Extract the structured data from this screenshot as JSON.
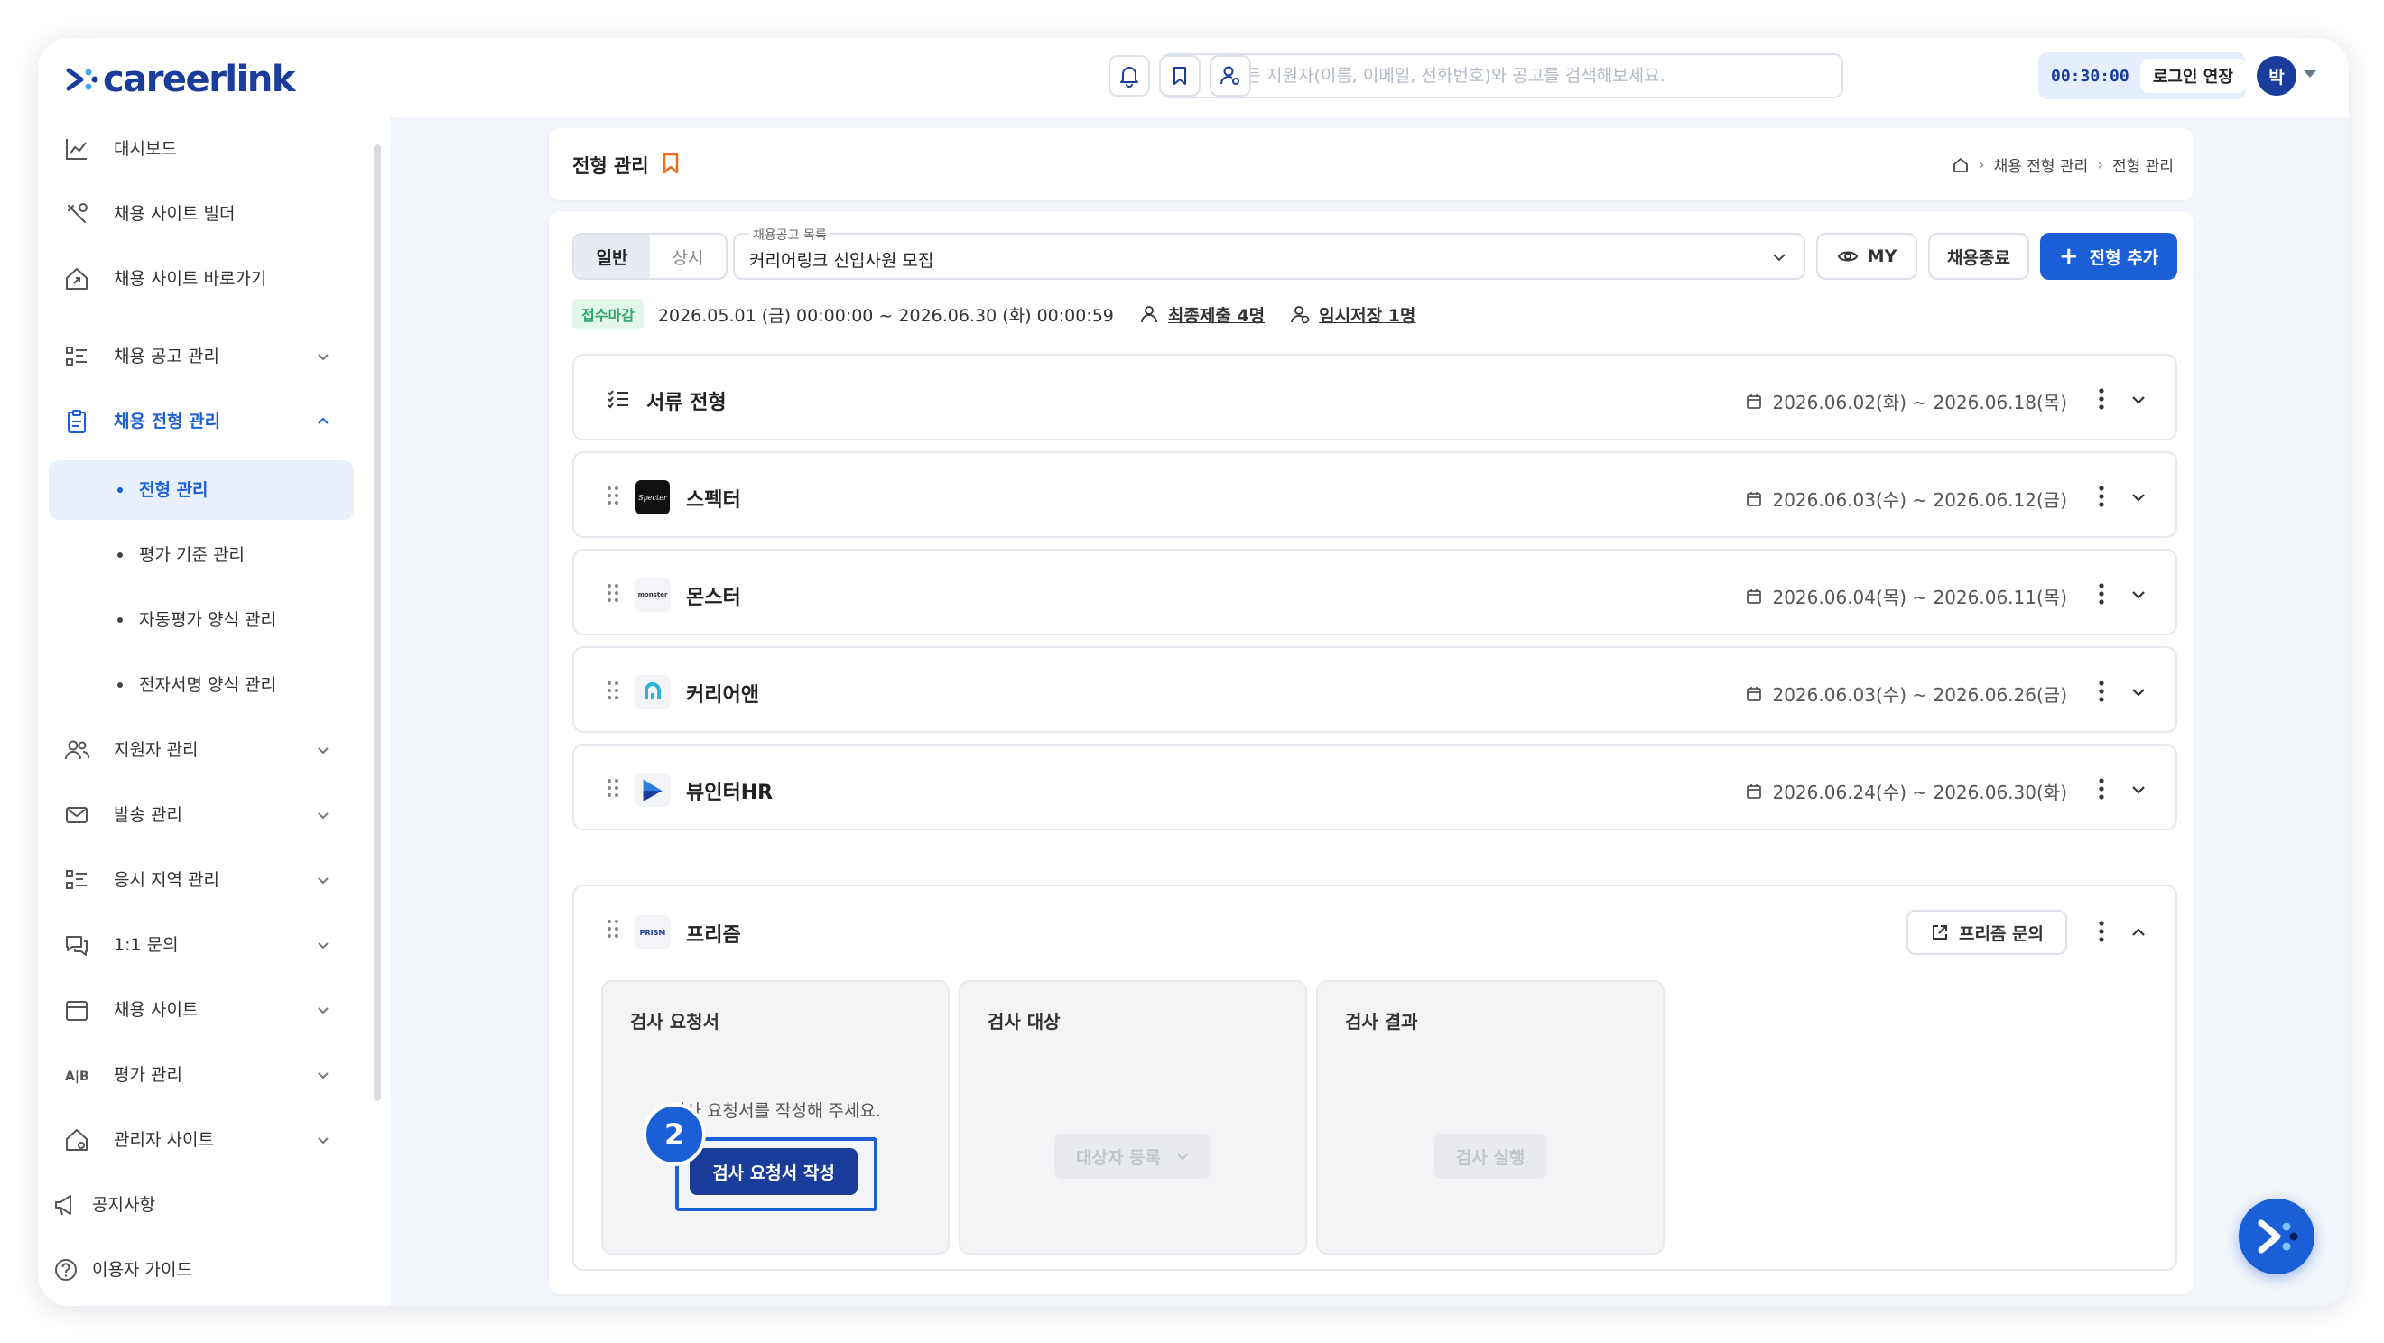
{
  "header": {
    "brand": "careerlink",
    "search_placeholder": "모든 지원자(이름, 이메일, 전화번호)와 공고를 검색해보세요.",
    "session_timer": "00:30:00",
    "extend_login_label": "로그인 연장",
    "avatar_initial": "박",
    "accent_color": "#1a5fd6"
  },
  "sidebar": {
    "items": [
      {
        "label": "대시보드",
        "icon": "chart-icon"
      },
      {
        "label": "채용 사이트 빌더",
        "icon": "tools-icon"
      },
      {
        "label": "채용 사이트 바로가기",
        "icon": "home-link-icon"
      },
      {
        "label": "채용 공고 관리",
        "icon": "list-icon"
      },
      {
        "label": "채용 전형 관리",
        "icon": "clipboard-icon"
      },
      {
        "label": "지원자 관리",
        "icon": "users-icon"
      },
      {
        "label": "발송 관리",
        "icon": "mail-icon"
      },
      {
        "label": "응시 지역 관리",
        "icon": "list-icon"
      },
      {
        "label": "1:1 문의",
        "icon": "chat-icon"
      },
      {
        "label": "채용 사이트",
        "icon": "calendar-icon"
      },
      {
        "label": "평가 관리",
        "icon": "ab-icon"
      },
      {
        "label": "관리자 사이트",
        "icon": "home-gear-icon"
      }
    ],
    "subitems": [
      "전형 관리",
      "평가 기준 관리",
      "자동평가 양식 관리",
      "전자서명 양식 관리"
    ],
    "bottom": [
      "공지사항",
      "이용자 가이드"
    ]
  },
  "page": {
    "title": "전형 관리",
    "breadcrumb": [
      "채용 전형 관리",
      "전형 관리"
    ]
  },
  "toolbar": {
    "tab_general": "일반",
    "tab_regular": "상시",
    "select_caption": "채용공고 목록",
    "select_value": "커리어링크 신입사원 모집",
    "my_label": "MY",
    "end_label": "채용종료",
    "add_label": "전형 추가"
  },
  "status": {
    "badge": "접수마감",
    "period": "2026.05.01 (금) 00:00:00 ~ 2026.06.30 (화) 00:00:59",
    "final_submit": "최종제출 4명",
    "temp_save": "임시저장 1명"
  },
  "steps": [
    {
      "name": "서류 전형",
      "period": "2026.06.02(화) ~ 2026.06.18(목)"
    },
    {
      "name": "스펙터",
      "period": "2026.06.03(수) ~ 2026.06.12(금)"
    },
    {
      "name": "몬스터",
      "period": "2026.06.04(목) ~ 2026.06.11(목)"
    },
    {
      "name": "커리어앤",
      "period": "2026.06.03(수) ~ 2026.06.26(금)"
    },
    {
      "name": "뷰인터HR",
      "period": "2026.06.24(수) ~ 2026.06.30(화)"
    }
  ],
  "expanded": {
    "name": "프리즘",
    "inquiry_label": "프리즘 문의",
    "columns": [
      {
        "title": "검사 요청서",
        "hint": "검사 요청서를 작성해 주세요.",
        "button": "검사 요청서 작성"
      },
      {
        "title": "검사 대상",
        "button": "대상자 등록"
      },
      {
        "title": "검사 결과",
        "button": "검사 실행"
      }
    ],
    "marker_number": "2"
  },
  "logos": {
    "specter": "Specter",
    "monster": "monster",
    "prism": "PRISM"
  }
}
